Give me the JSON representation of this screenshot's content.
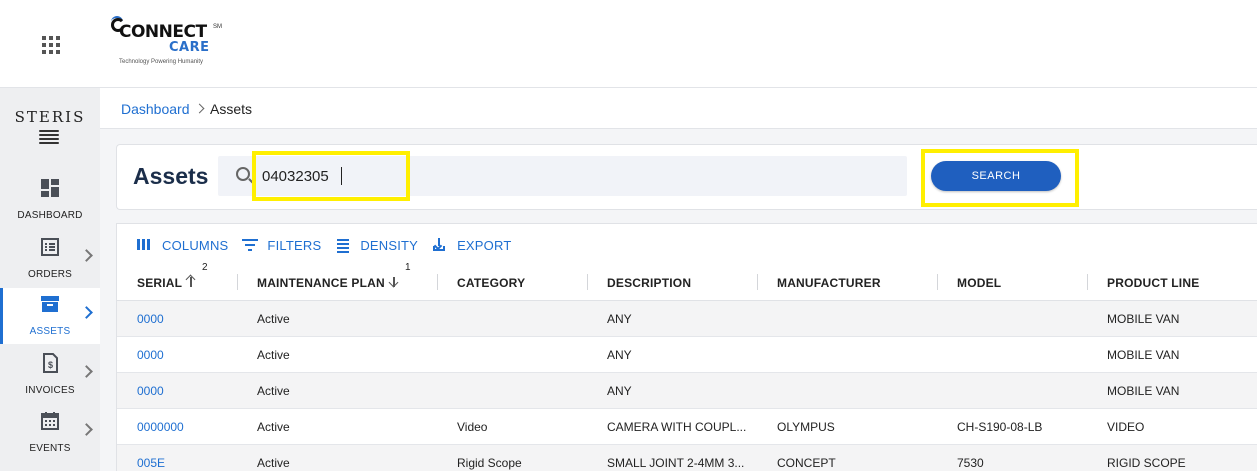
{
  "header": {
    "logo_connect": "CONNECT",
    "logo_care": "CARE",
    "logo_sm": "SM",
    "logo_tagline": "Technology Powering Humanity"
  },
  "sidebar": {
    "brand": "STERIS",
    "items": [
      {
        "label": "DASHBOARD",
        "icon": "dashboard-icon",
        "active": false,
        "has_chevron": false
      },
      {
        "label": "ORDERS",
        "icon": "orders-icon",
        "active": false,
        "has_chevron": true
      },
      {
        "label": "ASSETS",
        "icon": "assets-icon",
        "active": true,
        "has_chevron": true
      },
      {
        "label": "INVOICES",
        "icon": "invoices-icon",
        "active": false,
        "has_chevron": true
      },
      {
        "label": "EVENTS",
        "icon": "events-icon",
        "active": false,
        "has_chevron": true
      }
    ]
  },
  "breadcrumb": {
    "link": "Dashboard",
    "current": "Assets"
  },
  "search": {
    "title": "Assets",
    "value": "04032305",
    "button_label": "SEARCH"
  },
  "toolbar": {
    "columns": "COLUMNS",
    "filters": "FILTERS",
    "density": "DENSITY",
    "export": "EXPORT"
  },
  "table": {
    "columns": [
      "SERIAL",
      "MAINTENANCE PLAN",
      "CATEGORY",
      "DESCRIPTION",
      "MANUFACTURER",
      "MODEL",
      "PRODUCT LINE"
    ],
    "sort": {
      "serial_order": "2",
      "plan_order": "1"
    },
    "rows": [
      {
        "serial": "0000",
        "plan": "Active",
        "category": "",
        "description": "ANY",
        "manufacturer": "",
        "model": "",
        "product_line": "MOBILE VAN"
      },
      {
        "serial": "0000",
        "plan": "Active",
        "category": "",
        "description": "ANY",
        "manufacturer": "",
        "model": "",
        "product_line": "MOBILE VAN"
      },
      {
        "serial": "0000",
        "plan": "Active",
        "category": "",
        "description": "ANY",
        "manufacturer": "",
        "model": "",
        "product_line": "MOBILE VAN"
      },
      {
        "serial": "0000000",
        "plan": "Active",
        "category": "Video",
        "description": "CAMERA WITH COUPL...",
        "manufacturer": "OLYMPUS",
        "model": "CH-S190-08-LB",
        "product_line": "VIDEO"
      },
      {
        "serial": "005E",
        "plan": "Active",
        "category": "Rigid Scope",
        "description": "SMALL JOINT 2-4MM 3...",
        "manufacturer": "CONCEPT",
        "model": "7530",
        "product_line": "RIGID SCOPE"
      }
    ]
  },
  "colors": {
    "accent": "#1f6fd1",
    "button": "#1f5fbf",
    "highlight": "#ffef00",
    "title": "#1b2e4a"
  }
}
